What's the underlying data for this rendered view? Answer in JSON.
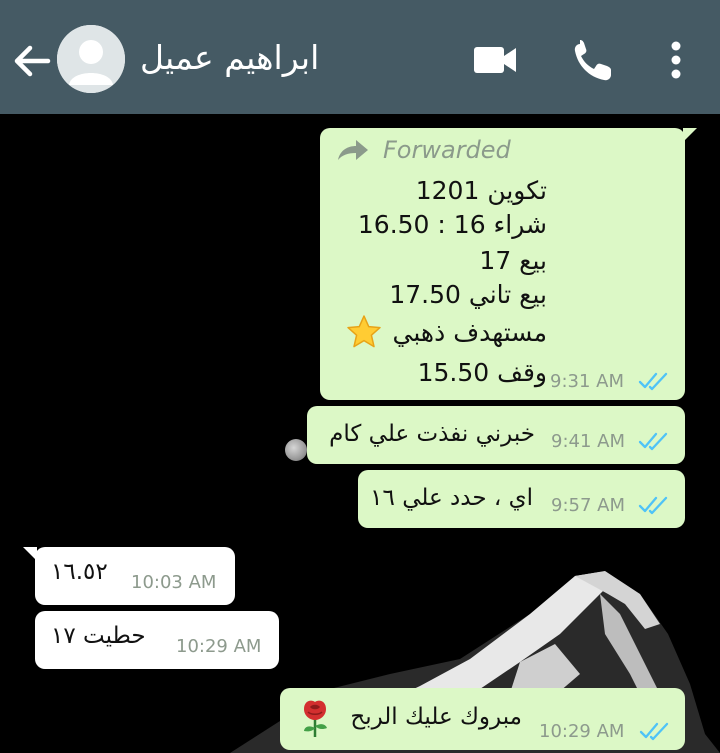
{
  "header": {
    "contact_name": "ابراهيم عميل",
    "background": "#455a64"
  },
  "icons": {
    "back": "arrow-back-icon",
    "avatar": "default-avatar-icon",
    "video": "video-camera-icon",
    "call": "phone-icon",
    "menu": "vertical-dots-icon",
    "forward": "forward-arrow-icon",
    "ticks": "double-check-read-icon",
    "star": "star-emoji",
    "rose": "rose-emoji"
  },
  "colors": {
    "outgoing_bubble": "#dcf8c6",
    "incoming_bubble": "#ffffff",
    "read_ticks": "#4fc3f7",
    "chat_background": "#000000"
  },
  "messages": [
    {
      "direction": "outgoing",
      "forwarded_label": "Forwarded",
      "lines": [
        "تكوين 1201",
        "شراء 16 : 16.50",
        "بيع 17",
        "بيع تاني 17.50",
        "مستهدف ذهبي",
        "وقف 15.50"
      ],
      "time": "9:31 AM"
    },
    {
      "direction": "outgoing",
      "text": "خبرني نفذت علي كام",
      "time": "9:41 AM"
    },
    {
      "direction": "outgoing",
      "text": "اي ، حدد علي ١٦",
      "time": "9:57 AM"
    },
    {
      "direction": "incoming",
      "text": "١٦.٥٢",
      "time": "10:03 AM"
    },
    {
      "direction": "incoming",
      "text": "حطيت ١٧",
      "time": "10:29 AM"
    },
    {
      "direction": "outgoing",
      "text": "مبروك عليك الربح",
      "time": "10:29 AM"
    }
  ]
}
